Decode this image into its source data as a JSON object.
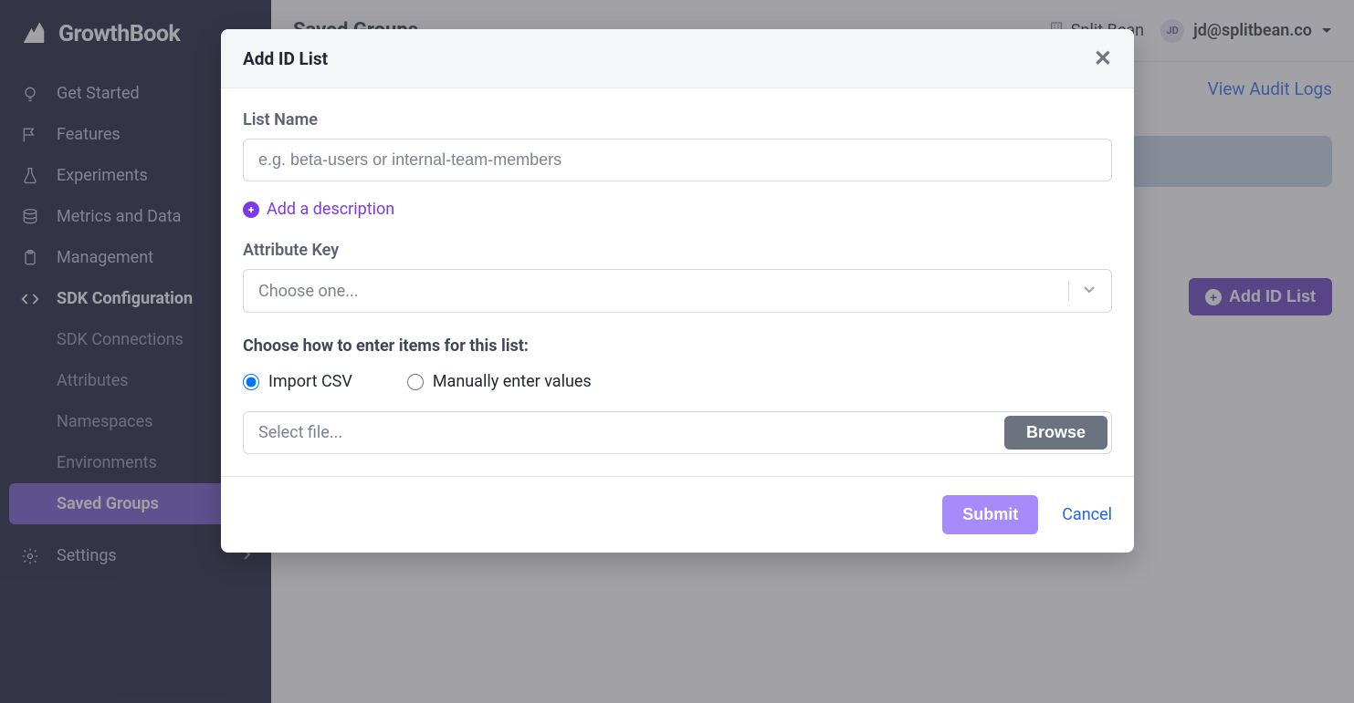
{
  "brand": {
    "name": "GrowthBook"
  },
  "sidebar": {
    "items": [
      {
        "label": "Get Started"
      },
      {
        "label": "Features"
      },
      {
        "label": "Experiments"
      },
      {
        "label": "Metrics and Data"
      },
      {
        "label": "Management"
      },
      {
        "label": "SDK Configuration"
      }
    ],
    "sub_items": [
      {
        "label": "SDK Connections"
      },
      {
        "label": "Attributes"
      },
      {
        "label": "Namespaces"
      },
      {
        "label": "Environments"
      },
      {
        "label": "Saved Groups"
      }
    ],
    "settings_label": "Settings"
  },
  "topbar": {
    "page_title": "Saved Groups",
    "org_name": "Split Bean",
    "user_initials": "JD",
    "user_email": "jd@splitbean.co"
  },
  "content": {
    "audit_link": "View Audit Logs",
    "add_button": "Add ID List"
  },
  "modal": {
    "title": "Add ID List",
    "list_name_label": "List Name",
    "list_name_placeholder": "e.g. beta-users or internal-team-members",
    "list_name_value": "",
    "add_description": "Add a description",
    "attribute_key_label": "Attribute Key",
    "attribute_key_placeholder": "Choose one...",
    "choose_mode_label": "Choose how to enter items for this list:",
    "radio_import_csv": "Import CSV",
    "radio_manual": "Manually enter values",
    "file_placeholder": "Select file...",
    "browse_label": "Browse",
    "submit_label": "Submit",
    "cancel_label": "Cancel"
  }
}
